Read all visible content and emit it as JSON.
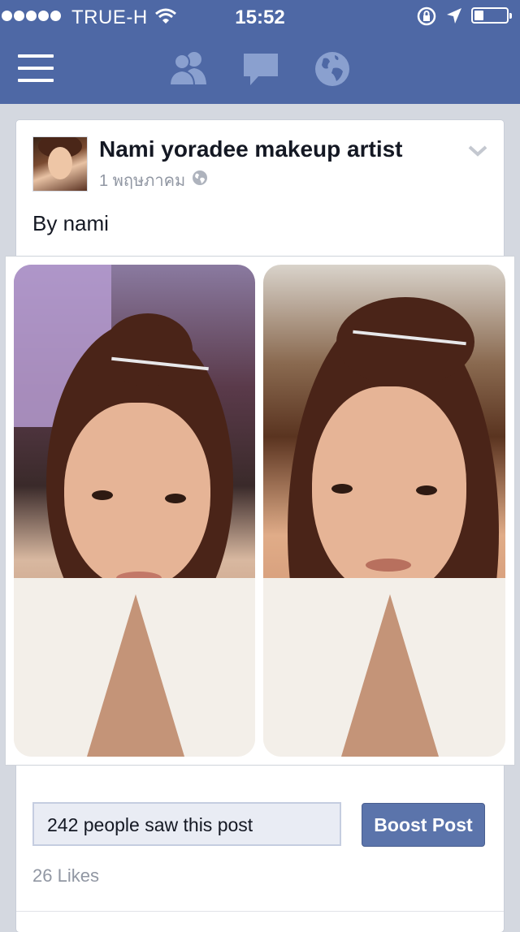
{
  "status_bar": {
    "carrier": "TRUE-H",
    "time": "15:52",
    "signal_bars": 5,
    "battery_level": 0.3
  },
  "nav": {
    "icons": [
      "menu-icon",
      "friends-icon",
      "messages-icon",
      "globe-icon"
    ]
  },
  "post": {
    "author": "Nami yoradee makeup artist",
    "date": "1 พฤษภาคม",
    "text": "By nami",
    "reach_text": "242 people saw this post",
    "boost_label": "Boost Post",
    "likes": "26 Likes"
  },
  "colors": {
    "nav_bar": "#4e68a5",
    "boost_button": "#5b74ab",
    "background": "#d4d8e0"
  }
}
